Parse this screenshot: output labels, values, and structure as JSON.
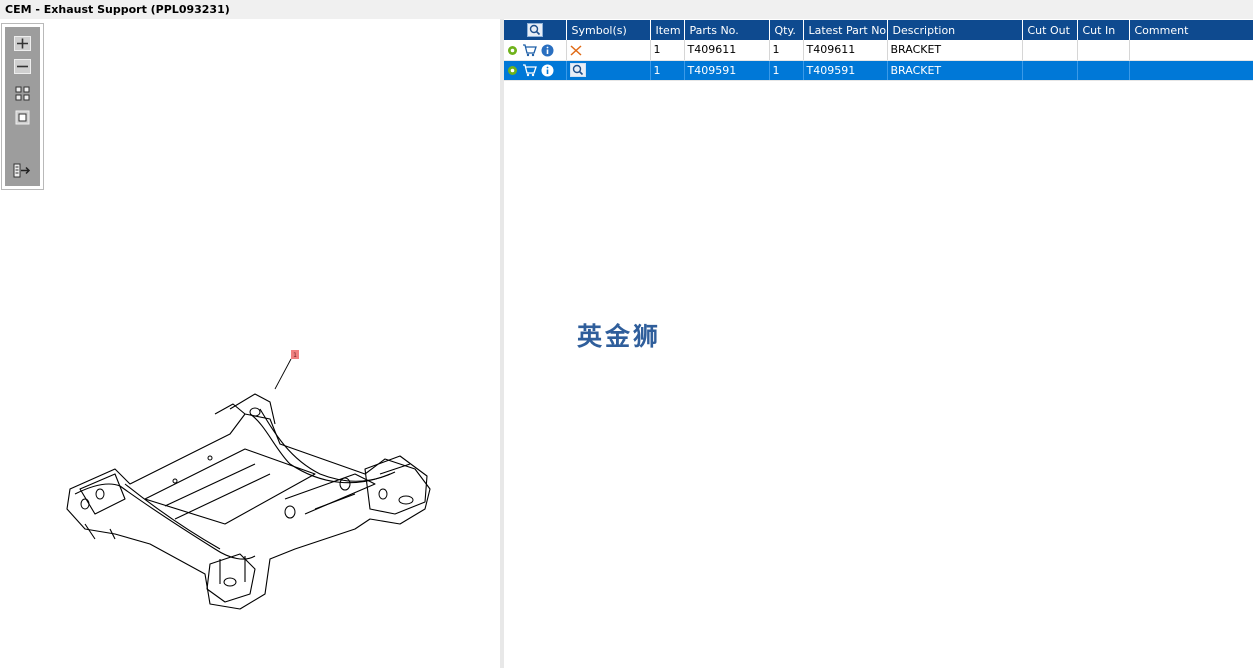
{
  "window": {
    "title": "CEM - Exhaust Support (PPL093231)"
  },
  "toolbox": {
    "buttons": [
      {
        "icon": "zoom-in-icon"
      },
      {
        "icon": "zoom-out-icon"
      },
      {
        "icon": "fit-all-icon"
      },
      {
        "icon": "fit-window-icon"
      },
      {
        "icon": "export-icon"
      }
    ]
  },
  "drawing": {
    "callout_label": "1",
    "callout_color": "#f08080"
  },
  "table": {
    "columns": [
      "Symbol(s)",
      "Item",
      "Parts No.",
      "Qty.",
      "Latest Part No.",
      "Description",
      "Cut Out",
      "Cut In",
      "Comment"
    ],
    "rows": [
      {
        "item": "1",
        "parts_no": "T409611",
        "qty": "1",
        "latest_part_no": "T409611",
        "description": "BRACKET",
        "cut_out": "",
        "cut_in": "",
        "comment": "",
        "symbol": "cross-icon",
        "selected": false
      },
      {
        "item": "1",
        "parts_no": "T409591",
        "qty": "1",
        "latest_part_no": "T409591",
        "description": "BRACKET",
        "cut_out": "",
        "cut_in": "",
        "comment": "",
        "symbol": "magnifier-icon",
        "selected": true
      }
    ]
  },
  "watermark": "英金狮",
  "colors": {
    "header": "#0e4a8f",
    "selected_row": "#0078d7",
    "watermark": "#2f5e9b"
  }
}
